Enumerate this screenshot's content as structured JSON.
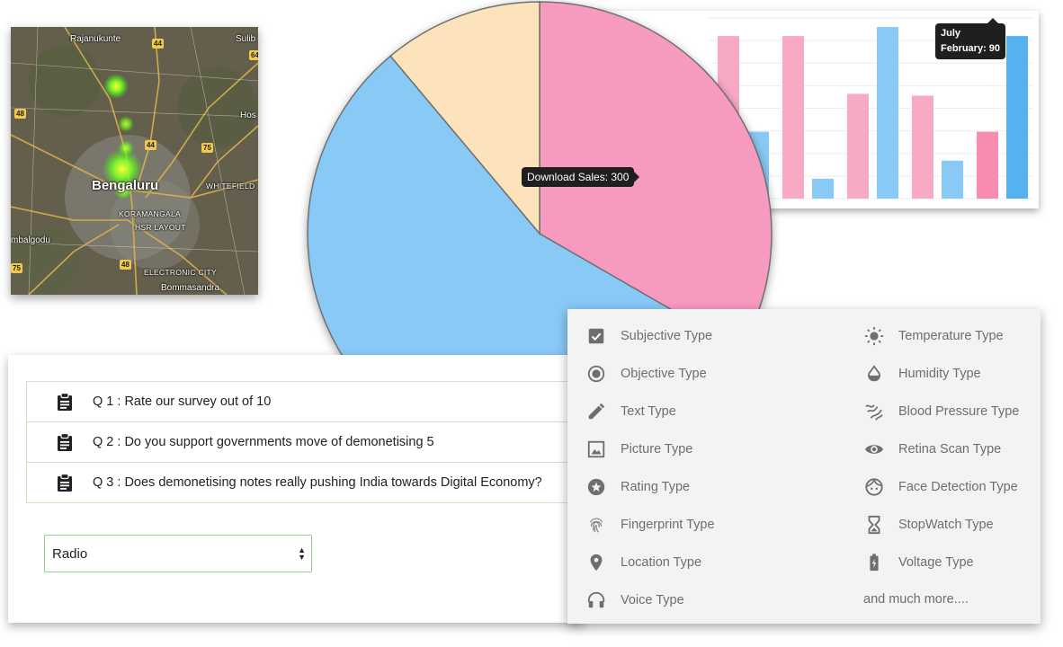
{
  "map": {
    "labels": [
      "Rajanukunte",
      "Sulib",
      "Hos",
      "Bengaluru",
      "WHITEFIELD",
      "KORAMANGALA",
      "HSR LAYOUT",
      "mbalgodu",
      "ELECTRONIC CITY",
      "Bommasandra"
    ],
    "highways": [
      "44",
      "64",
      "48",
      "44",
      "75",
      "48",
      "75"
    ]
  },
  "bar_chart": {
    "tooltip_title": "July",
    "tooltip_value": "February: 90"
  },
  "chart_data": [
    {
      "type": "pie",
      "slices": [
        {
          "name": "Download Sales",
          "value": 300,
          "color": "#f79ac0"
        },
        {
          "name": "",
          "value": 500,
          "color": "#88c9f6"
        },
        {
          "name": "",
          "value": 100,
          "color": "#fde3bc"
        }
      ],
      "tooltip": "Download Sales: 300"
    },
    {
      "type": "bar",
      "categories": [
        "",
        "",
        "",
        "",
        "July"
      ],
      "series": [
        {
          "name": "",
          "color": "#f8a9c6",
          "values": [
            90,
            90,
            58,
            57,
            37
          ]
        },
        {
          "name": "February",
          "color": "#88c9f6",
          "values": [
            37,
            11,
            95,
            21,
            90
          ]
        }
      ],
      "ylim": [
        0,
        100
      ],
      "grid": true
    }
  ],
  "survey": {
    "questions": [
      "Q 1 : Rate our survey out of 10",
      "Q 2 : Do you support governments move of demonetising 5",
      "Q 3 : Does demonetising notes really pushing India towards Digital Economy?"
    ],
    "select_value": "Radio"
  },
  "types": {
    "left": [
      {
        "label": "Subjective Type",
        "icon": "checkbox-icon"
      },
      {
        "label": "Objective Type",
        "icon": "radio-icon"
      },
      {
        "label": "Text Type",
        "icon": "pencil-icon"
      },
      {
        "label": "Picture Type",
        "icon": "image-icon"
      },
      {
        "label": "Rating Type",
        "icon": "star-icon"
      },
      {
        "label": "Fingerprint Type",
        "icon": "fingerprint-icon"
      },
      {
        "label": "Location Type",
        "icon": "location-pin-icon"
      },
      {
        "label": "Voice Type",
        "icon": "headset-icon"
      }
    ],
    "right": [
      {
        "label": "Temperature Type",
        "icon": "sun-icon"
      },
      {
        "label": "Humidity Type",
        "icon": "drop-icon"
      },
      {
        "label": "Blood Pressure Type",
        "icon": "wave-icon"
      },
      {
        "label": "Retina Scan Type",
        "icon": "eye-icon"
      },
      {
        "label": "Face Detection Type",
        "icon": "face-icon"
      },
      {
        "label": "StopWatch Type",
        "icon": "hourglass-icon"
      },
      {
        "label": "Voltage Type",
        "icon": "battery-icon"
      }
    ],
    "more": "and much more...."
  }
}
